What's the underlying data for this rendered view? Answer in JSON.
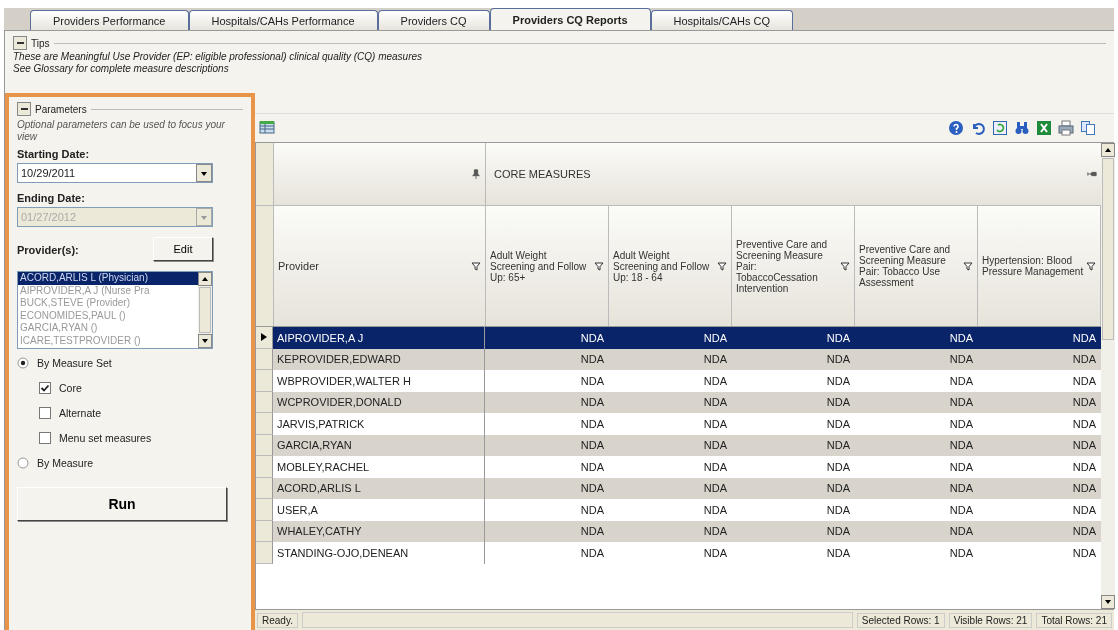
{
  "tabs": [
    {
      "label": "Providers Performance",
      "selected": false
    },
    {
      "label": "Hospitals/CAHs Performance",
      "selected": false
    },
    {
      "label": "Providers CQ",
      "selected": false
    },
    {
      "label": "Providers CQ Reports",
      "selected": true
    },
    {
      "label": "Hospitals/CAHs CQ",
      "selected": false
    }
  ],
  "tips": {
    "title": "Tips",
    "expanded": true,
    "lines": [
      "These are Meaningful Use Provider (EP: eligible professional) clinical quality (CQ) measures",
      "See Glossary for complete measure descriptions"
    ]
  },
  "parameters": {
    "title": "Parameters",
    "expanded": true,
    "hint": "Optional parameters can be used to focus your view",
    "starting_date": {
      "label": "Starting Date:",
      "value": "10/29/2011",
      "disabled": false
    },
    "ending_date": {
      "label": "Ending Date:",
      "value": "01/27/2012",
      "disabled": true
    },
    "providers_label": "Provider(s):",
    "edit_button": "Edit",
    "providers": [
      {
        "label": "ACORD,ARLIS L (Physician)",
        "selected": true
      },
      {
        "label": "AIPROVIDER,A J (Nurse Pra",
        "selected": false
      },
      {
        "label": "BUCK,STEVE (Provider)",
        "selected": false
      },
      {
        "label": "ECONOMIDES,PAUL ()",
        "selected": false
      },
      {
        "label": "GARCIA,RYAN ()",
        "selected": false
      },
      {
        "label": "ICARE,TESTPROVIDER ()",
        "selected": false
      }
    ],
    "options": [
      {
        "kind": "radio",
        "label": "By Measure Set",
        "selected": true
      },
      {
        "kind": "checkbox",
        "label": "Core",
        "checked": true
      },
      {
        "kind": "checkbox",
        "label": "Alternate",
        "checked": false
      },
      {
        "kind": "checkbox",
        "label": "Menu set measures",
        "checked": false
      },
      {
        "kind": "radio",
        "label": "By Measure",
        "selected": false
      }
    ],
    "run_button": "Run"
  },
  "table": {
    "group_header": "CORE MEASURES",
    "columns": [
      "Provider",
      "Adult Weight Screening and Follow Up: 65+",
      "Adult Weight Screening and Follow Up: 18 - 64",
      "Preventive Care and Screening Measure Pair: TobaccoCessation Intervention",
      "Preventive Care and Screening Measure Pair: Tobacco Use Assessment",
      "Hypertension: Blood Pressure Management"
    ],
    "rows": [
      {
        "provider": "AIPROVIDER,A J",
        "values": [
          "NDA",
          "NDA",
          "NDA",
          "NDA",
          "NDA"
        ],
        "selected": true
      },
      {
        "provider": "KEPROVIDER,EDWARD",
        "values": [
          "NDA",
          "NDA",
          "NDA",
          "NDA",
          "NDA"
        ],
        "selected": false
      },
      {
        "provider": "WBPROVIDER,WALTER H",
        "values": [
          "NDA",
          "NDA",
          "NDA",
          "NDA",
          "NDA"
        ],
        "selected": false
      },
      {
        "provider": "WCPROVIDER,DONALD",
        "values": [
          "NDA",
          "NDA",
          "NDA",
          "NDA",
          "NDA"
        ],
        "selected": false
      },
      {
        "provider": "JARVIS,PATRICK",
        "values": [
          "NDA",
          "NDA",
          "NDA",
          "NDA",
          "NDA"
        ],
        "selected": false
      },
      {
        "provider": "GARCIA,RYAN",
        "values": [
          "NDA",
          "NDA",
          "NDA",
          "NDA",
          "NDA"
        ],
        "selected": false
      },
      {
        "provider": "MOBLEY,RACHEL",
        "values": [
          "NDA",
          "NDA",
          "NDA",
          "NDA",
          "NDA"
        ],
        "selected": false
      },
      {
        "provider": "ACORD,ARLIS L",
        "values": [
          "NDA",
          "NDA",
          "NDA",
          "NDA",
          "NDA"
        ],
        "selected": false
      },
      {
        "provider": "USER,A",
        "values": [
          "NDA",
          "NDA",
          "NDA",
          "NDA",
          "NDA"
        ],
        "selected": false
      },
      {
        "provider": "WHALEY,CATHY",
        "values": [
          "NDA",
          "NDA",
          "NDA",
          "NDA",
          "NDA"
        ],
        "selected": false
      },
      {
        "provider": "STANDING-OJO,DENEAN",
        "values": [
          "NDA",
          "NDA",
          "NDA",
          "NDA",
          "NDA"
        ],
        "selected": false
      }
    ]
  },
  "status_bar": {
    "status": "Ready.",
    "selected_rows": "Selected Rows: 1",
    "visible_rows": "Visible Rows: 21",
    "total_rows": "Total Rows: 21"
  }
}
